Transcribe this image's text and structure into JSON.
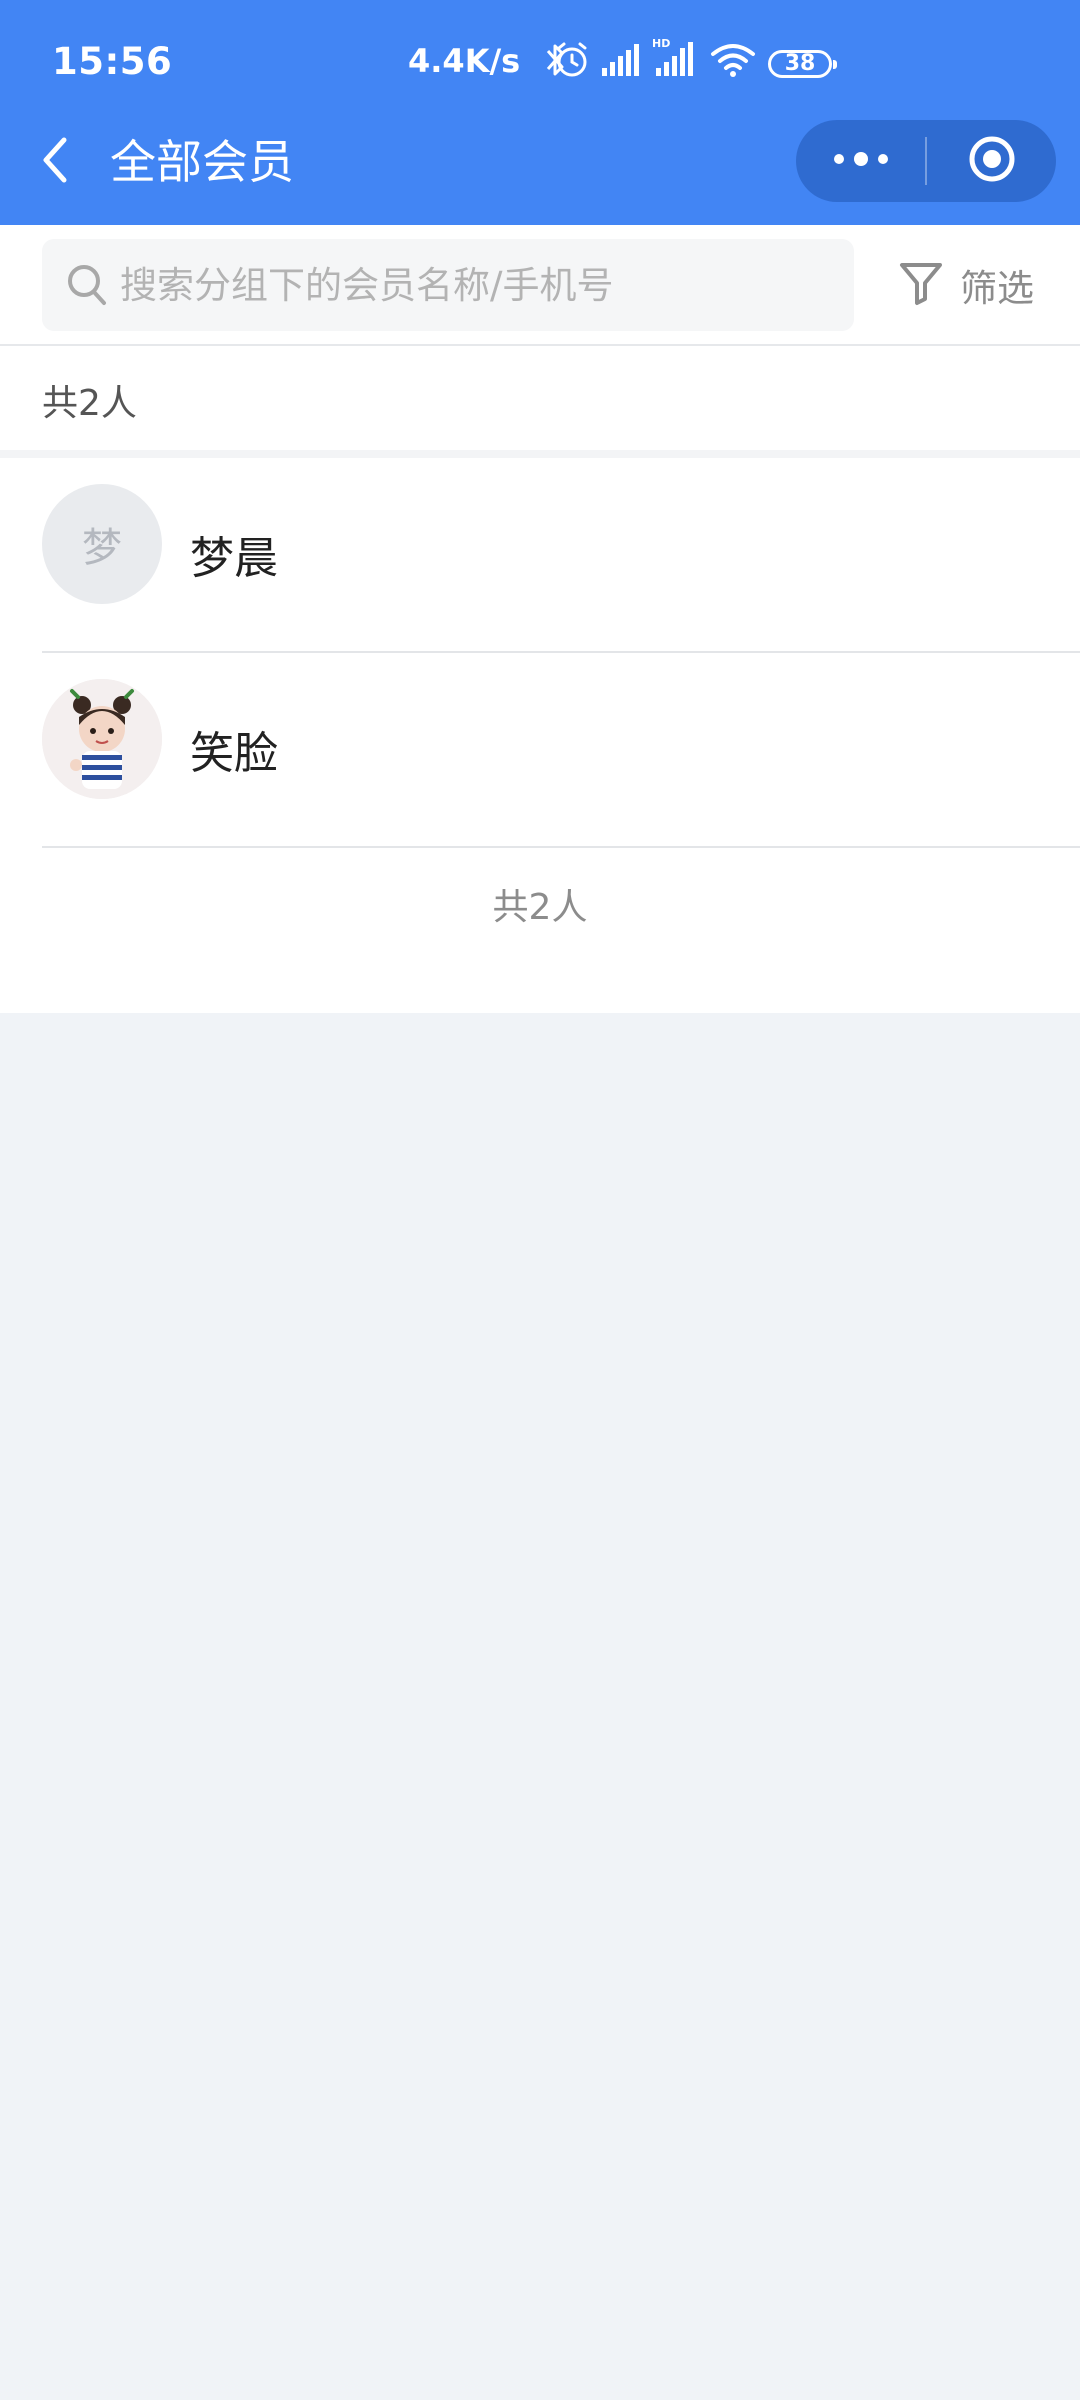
{
  "status_bar": {
    "time": "15:56",
    "net_speed": "4.4K/s",
    "battery": "38",
    "icons": [
      "bluetooth-icon",
      "alarm-icon",
      "signal-icon",
      "hd-signal-icon",
      "wifi-icon",
      "battery-icon"
    ]
  },
  "nav": {
    "title": "全部会员",
    "back_icon": "chevron-left-icon",
    "more_icon": "more-dots-icon",
    "close_icon": "target-icon",
    "accent_color": "#4285f4"
  },
  "search": {
    "placeholder": "搜索分组下的会员名称/手机号",
    "value": "",
    "icon": "search-icon"
  },
  "filter": {
    "label": "筛选",
    "icon": "funnel-icon"
  },
  "summary": {
    "count_text": "共2人"
  },
  "members": [
    {
      "name": "梦晨",
      "avatar_text": "梦"
    },
    {
      "name": "笑脸",
      "avatar_text": ""
    }
  ],
  "footer": {
    "count_text": "共2人"
  }
}
